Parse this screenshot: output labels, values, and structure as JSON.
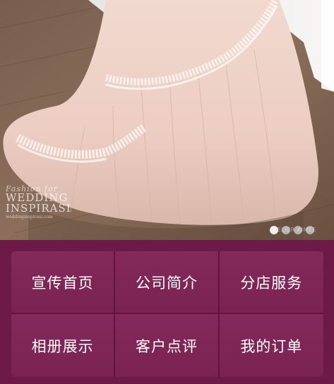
{
  "hero": {
    "watermark": {
      "script": "Fashion for",
      "line1": "WEDDING",
      "line2": "INSPIRASI",
      "url": "weddinginspirasi.com"
    },
    "credit": "ATELIER AIMEE",
    "carousel": {
      "total_slides": 4,
      "active_index": 0
    }
  },
  "menu": {
    "items": [
      {
        "label": "宣传首页"
      },
      {
        "label": "公司简介"
      },
      {
        "label": "分店服务"
      },
      {
        "label": "相册展示"
      },
      {
        "label": "客户点评"
      },
      {
        "label": "我的订单"
      }
    ]
  },
  "colors": {
    "background": "#6e1a48",
    "tile": "#7f2756",
    "divider": "#621441",
    "label": "#ffffff"
  }
}
